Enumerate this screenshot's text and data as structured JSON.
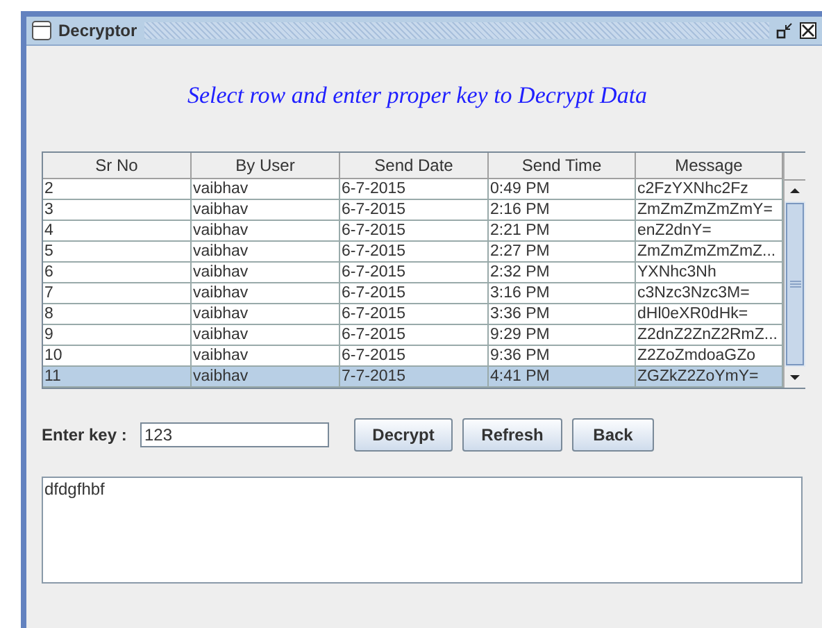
{
  "window": {
    "title": "Decryptor"
  },
  "heading": "Select row and enter proper key to Decrypt Data",
  "table": {
    "columns": [
      "Sr No",
      "By User",
      "Send Date",
      "Send Time",
      "Message"
    ],
    "rows": [
      {
        "cells": [
          "2",
          "vaibhav",
          "6-7-2015",
          "0:49 PM",
          "c2FzYXNhc2Fz"
        ],
        "selected": false
      },
      {
        "cells": [
          "3",
          "vaibhav",
          "6-7-2015",
          "2:16 PM",
          "ZmZmZmZmZmY="
        ],
        "selected": false
      },
      {
        "cells": [
          "4",
          "vaibhav",
          "6-7-2015",
          "2:21 PM",
          "enZ2dnY="
        ],
        "selected": false
      },
      {
        "cells": [
          "5",
          "vaibhav",
          "6-7-2015",
          "2:27 PM",
          "ZmZmZmZmZmZ..."
        ],
        "selected": false
      },
      {
        "cells": [
          "6",
          "vaibhav",
          "6-7-2015",
          "2:32 PM",
          "YXNhc3Nh"
        ],
        "selected": false
      },
      {
        "cells": [
          "7",
          "vaibhav",
          "6-7-2015",
          "3:16 PM",
          "c3Nzc3Nzc3M="
        ],
        "selected": false
      },
      {
        "cells": [
          "8",
          "vaibhav",
          "6-7-2015",
          "3:36 PM",
          "dHl0eXR0dHk="
        ],
        "selected": false
      },
      {
        "cells": [
          "9",
          "vaibhav",
          "6-7-2015",
          "9:29 PM",
          "Z2dnZ2ZnZ2RmZ..."
        ],
        "selected": false
      },
      {
        "cells": [
          "10",
          "vaibhav",
          "6-7-2015",
          "9:36 PM",
          "Z2ZoZmdoaGZo"
        ],
        "selected": false
      },
      {
        "cells": [
          "11",
          "vaibhav",
          "7-7-2015",
          "4:41 PM",
          "ZGZkZ2ZoYmY="
        ],
        "selected": true
      }
    ]
  },
  "key_label": "Enter key :",
  "key_field": {
    "value": "123"
  },
  "buttons": [
    "Decrypt",
    "Refresh",
    "Back"
  ],
  "output": {
    "value": "dfdgfhbf"
  }
}
